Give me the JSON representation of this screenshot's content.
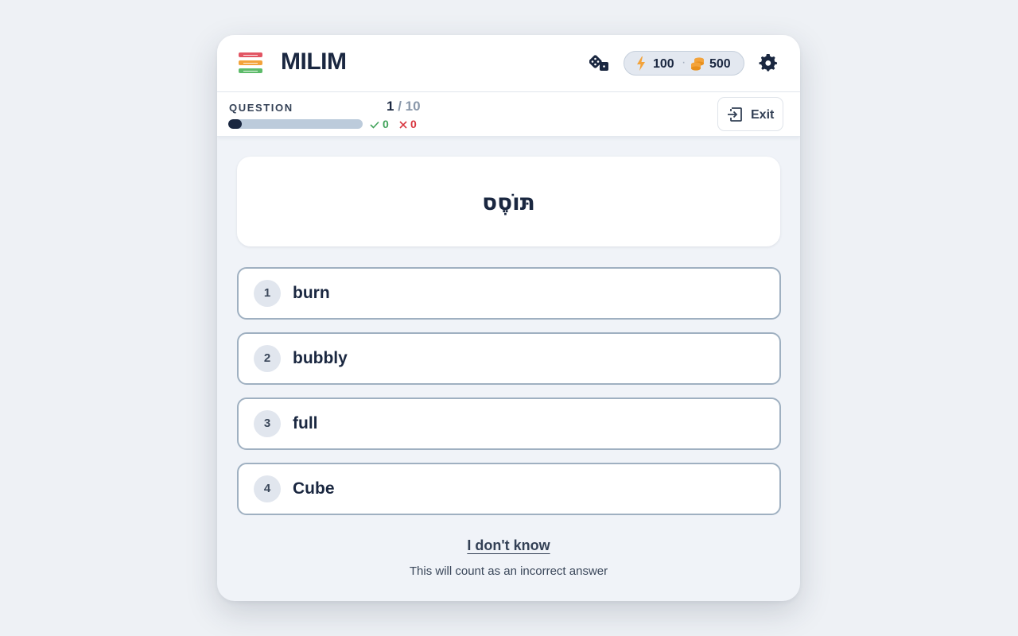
{
  "app": {
    "title": "MILIM"
  },
  "colors": {
    "logo_bars": [
      "#e25563",
      "#f3a33b",
      "#5dbb6a"
    ],
    "accent": "#1a2740",
    "correct": "#41a35a",
    "wrong": "#d8363f"
  },
  "header": {
    "icons": [
      "dice-icon",
      "lightning-icon",
      "coins-icon",
      "gear-icon"
    ],
    "energy": "100",
    "separator": "·",
    "coins": "500"
  },
  "question_bar": {
    "label": "QUESTION",
    "current": "1",
    "total": "/ 10",
    "progress_fraction": 0.1,
    "correct_count": "0",
    "wrong_count": "0",
    "exit_label": "Exit"
  },
  "prompt": {
    "word": "תּוֹסֶס"
  },
  "options": [
    {
      "number": "1",
      "label": "burn"
    },
    {
      "number": "2",
      "label": "bubbly"
    },
    {
      "number": "3",
      "label": "full"
    },
    {
      "number": "4",
      "label": "Cube"
    }
  ],
  "footer": {
    "dont_know": "I don't know",
    "hint": "This will count as an incorrect answer"
  }
}
